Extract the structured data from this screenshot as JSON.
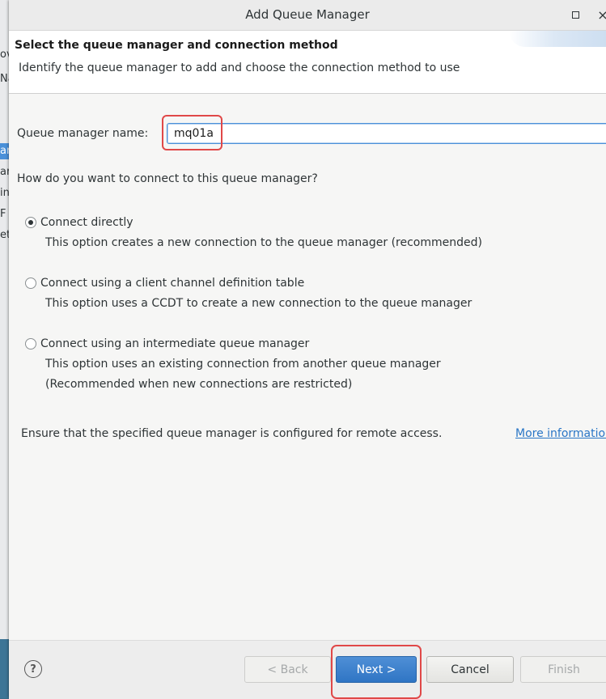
{
  "window": {
    "title": "Add Queue Manager",
    "close_glyph": "×"
  },
  "header": {
    "title": "Select the queue manager and connection method",
    "description": "Identify the queue manager to add and choose the connection method to use"
  },
  "form": {
    "qm_label": "Queue manager name:",
    "qm_value": "mq01a",
    "question": "How do you want to connect to this queue manager?",
    "options": [
      {
        "label": "Connect directly",
        "desc": [
          "This option creates a new connection to the queue manager (recommended)"
        ],
        "selected": true
      },
      {
        "label": "Connect using a client channel definition table",
        "desc": [
          "This option uses a CCDT to create a new connection to the queue manager"
        ],
        "selected": false
      },
      {
        "label": "Connect using an intermediate queue manager",
        "desc": [
          "This option uses an existing connection from another queue manager",
          "(Recommended when new connections are restricted)"
        ],
        "selected": false
      }
    ],
    "ensure_text": "Ensure that the specified queue manager is configured for remote access.",
    "more_info_link": "More information"
  },
  "footer": {
    "help_glyph": "?",
    "back_label": "< Back",
    "next_label": "Next >",
    "cancel_label": "Cancel",
    "finish_label": "Finish"
  },
  "background_window": {
    "fragments": [
      "ov",
      "Na",
      "ar",
      "ar",
      "in",
      "F",
      "et"
    ]
  },
  "colors": {
    "accent": "#2f75c4",
    "highlight": "#e04848",
    "link": "#2a76c6"
  }
}
